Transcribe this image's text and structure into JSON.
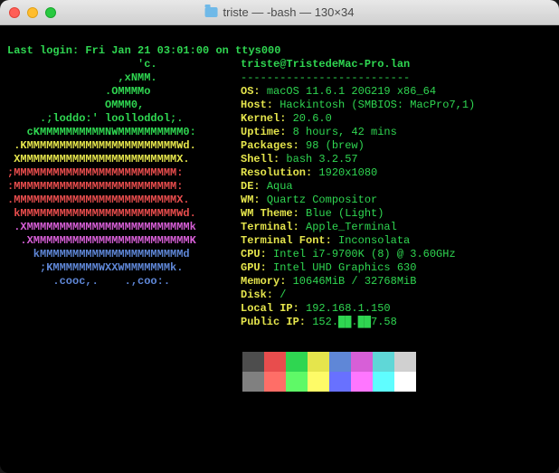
{
  "window": {
    "title": "triste — -bash — 130×34"
  },
  "login": "Last login: Fri Jan 21 03:01:00 on ttys000",
  "hostline": "triste@TristedeMac-Pro.lan",
  "divider": "--------------------------",
  "logo": [
    "                    'c.      ",
    "                 ,xNMM.      ",
    "               .OMMMMo       ",
    "               OMMM0,        ",
    "     .;loddo:' loolloddol;.  ",
    "   cKMMMMMMMMMMNWMMMMMMMMMM0:",
    " .KMMMMMMMMMMMMMMMMMMMMMMMWd.",
    " XMMMMMMMMMMMMMMMMMMMMMMMMX. ",
    ";MMMMMMMMMMMMMMMMMMMMMMMMM:  ",
    ":MMMMMMMMMMMMMMMMMMMMMMMMM:  ",
    ".MMMMMMMMMMMMMMMMMMMMMMMMMX. ",
    " kMMMMMMMMMMMMMMMMMMMMMMMMWd.",
    " .XMMMMMMMMMMMMMMMMMMMMMMMMMk",
    "  .XMMMMMMMMMMMMMMMMMMMMMMMMK",
    "    kMMMMMMMMMMMMMMMMMMMMMMd ",
    "     ;KMMMMMMMWXXWMMMMMMMk.  ",
    "       .cooc,.    .,coo:.    "
  ],
  "logo_colors": [
    "green",
    "green",
    "green",
    "green",
    "green",
    "green",
    "yellow",
    "yellow",
    "red",
    "red",
    "red",
    "red",
    "magenta",
    "magenta",
    "blue",
    "blue",
    "blue"
  ],
  "info": [
    {
      "k": "OS: ",
      "v": "macOS 11.6.1 20G219 x86_64"
    },
    {
      "k": "Host: ",
      "v": "Hackintosh (SMBIOS: MacPro7,1)"
    },
    {
      "k": "Kernel: ",
      "v": "20.6.0"
    },
    {
      "k": "Uptime: ",
      "v": "8 hours, 42 mins"
    },
    {
      "k": "Packages: ",
      "v": "98 (brew)"
    },
    {
      "k": "Shell: ",
      "v": "bash 3.2.57"
    },
    {
      "k": "Resolution: ",
      "v": "1920x1080"
    },
    {
      "k": "DE: ",
      "v": "Aqua"
    },
    {
      "k": "WM: ",
      "v": "Quartz Compositor"
    },
    {
      "k": "WM Theme: ",
      "v": "Blue (Light)"
    },
    {
      "k": "Terminal: ",
      "v": "Apple_Terminal"
    },
    {
      "k": "Terminal Font: ",
      "v": "Inconsolata"
    },
    {
      "k": "CPU: ",
      "v": "Intel i7-9700K (8) @ 3.60GHz"
    },
    {
      "k": "GPU: ",
      "v": "Intel UHD Graphics 630"
    },
    {
      "k": "Memory: ",
      "v": "10646MiB / 32768MiB"
    },
    {
      "k": "Disk: ",
      "v": "/"
    },
    {
      "k": "Local IP: ",
      "v": "192.168.1.150"
    },
    {
      "k": "Public IP: ",
      "v": "152.██.██7.58"
    }
  ],
  "swatches": [
    "#4d4d4d",
    "#e84d4d",
    "#2fd651",
    "#e5e54c",
    "#5f87d7",
    "#d75fd7",
    "#5fd7d7",
    "#d0d0d0",
    "#808080",
    "#ff6e67",
    "#5ff967",
    "#fefb67",
    "#6871ff",
    "#ff76ff",
    "#5ffdff",
    "#ffffff"
  ]
}
